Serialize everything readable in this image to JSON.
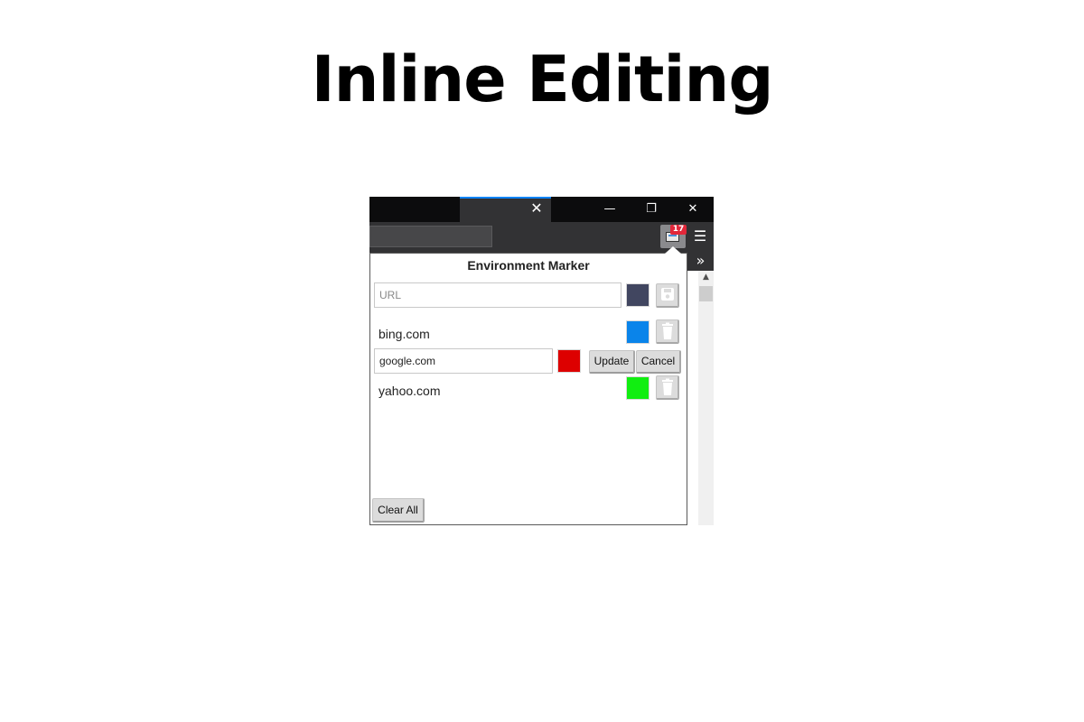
{
  "headline": "Inline Editing",
  "browser": {
    "tab_close_glyph": "✕",
    "window_controls": {
      "minimize": "—",
      "maximize": "❐",
      "close": "✕"
    },
    "extension_badge": "17",
    "menu_glyph": "☰",
    "overflow_glyph": "»",
    "scroll_up_glyph": "▲"
  },
  "popup": {
    "title": "Environment Marker",
    "new_entry": {
      "placeholder": "URL",
      "value": "",
      "color": "#414660",
      "save_icon": "save-icon"
    },
    "entries": [
      {
        "label": "bing.com",
        "color": "#0a84ea",
        "editing": false
      },
      {
        "label": "google.com",
        "color": "#dd0000",
        "editing": true
      },
      {
        "label": "yahoo.com",
        "color": "#11ee11",
        "editing": false
      }
    ],
    "update_label": "Update",
    "cancel_label": "Cancel",
    "clear_all_label": "Clear All"
  }
}
